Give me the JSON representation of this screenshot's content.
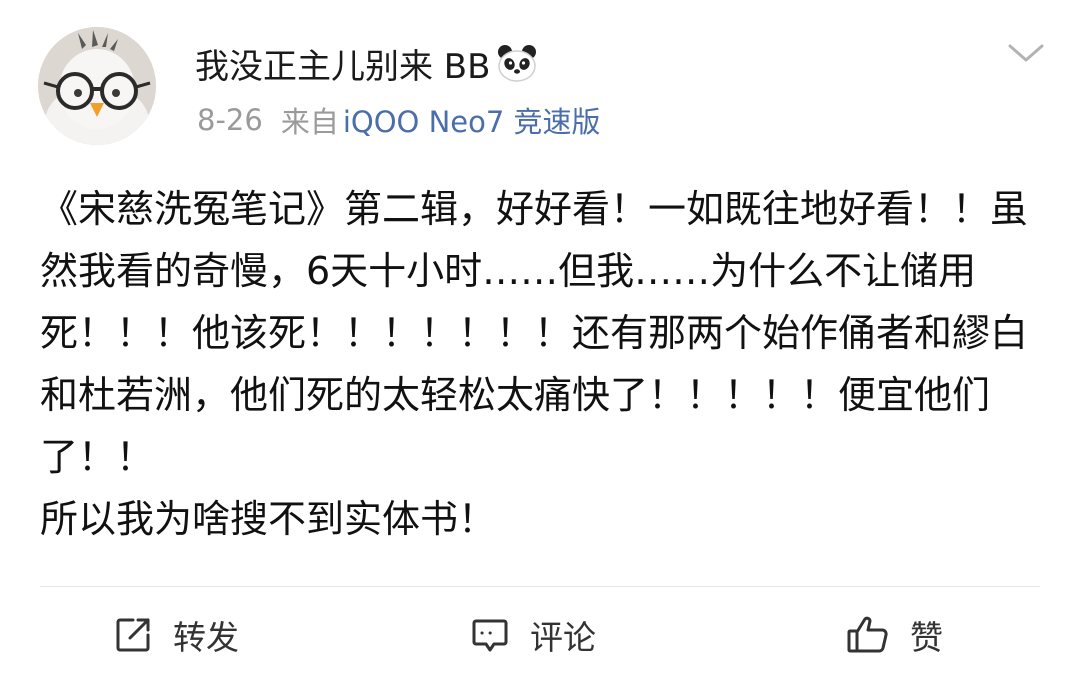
{
  "post": {
    "author": {
      "name": "我没正主儿别来 BB",
      "avatar_icon": "owl-plush-with-glasses-avatar",
      "badge_icon": "panda-emoji-icon"
    },
    "meta": {
      "time": "8-26",
      "from_label": "来自",
      "device": "iQOO Neo7 竞速版"
    },
    "menu_icon": "chevron-down-icon",
    "content": {
      "paragraph_1": "《宋慈洗冤笔记》第二辑，好好看！一如既往地好看！！虽然我看的奇慢，6天十小时……但我……为什么不让储用死！！！他该死！！！！！！！还有那两个始作俑者和繆白和杜若洲，他们死的太轻松太痛快了！！！！！便宜他们了！！",
      "paragraph_2": "所以我为啥搜不到实体书！"
    },
    "actions": {
      "repost": {
        "label": "转发",
        "icon": "share-icon"
      },
      "comment": {
        "label": "评论",
        "icon": "comment-icon"
      },
      "like": {
        "label": "赞",
        "icon": "thumbs-up-icon"
      }
    },
    "colors": {
      "link_blue": "#4a6ea9",
      "meta_gray": "#9a9a9a",
      "text": "#111111"
    }
  }
}
